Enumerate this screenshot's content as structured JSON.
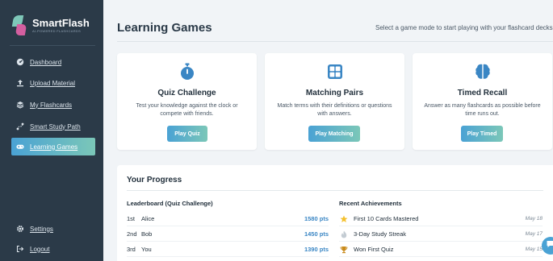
{
  "app": {
    "name": "SmartFlash",
    "tagline": "AI-POWERED FLASHCARDS"
  },
  "colors": {
    "sidebar_bg": "#2b3a48",
    "accent_blue": "#4aa2d4",
    "accent_teal": "#7bc7b8",
    "points_blue": "#3a86c4",
    "logo_pink": "#d45fa0"
  },
  "sidebar": {
    "items": [
      {
        "label": "Dashboard",
        "icon": "dashboard-gauge-icon",
        "active": false
      },
      {
        "label": "Upload Material",
        "icon": "upload-icon",
        "active": false
      },
      {
        "label": "My Flashcards",
        "icon": "layers-icon",
        "active": false
      },
      {
        "label": "Smart Study Path",
        "icon": "route-icon",
        "active": false
      },
      {
        "label": "Learning Games",
        "icon": "gamepad-icon",
        "active": true
      }
    ],
    "bottom_items": [
      {
        "label": "Settings",
        "icon": "gear-icon"
      },
      {
        "label": "Logout",
        "icon": "logout-icon"
      }
    ]
  },
  "main": {
    "title": "Learning Games",
    "subtitle": "Select a game mode to start playing with your flashcard decks."
  },
  "games": [
    {
      "title": "Quiz Challenge",
      "description": "Test your knowledge against the clock or compete with friends.",
      "button": "Play Quiz",
      "icon": "stopwatch-icon"
    },
    {
      "title": "Matching Pairs",
      "description": "Match terms with their definitions or questions with answers.",
      "button": "Play Matching",
      "icon": "grid-icon"
    },
    {
      "title": "Timed Recall",
      "description": "Answer as many flashcards as possible before time runs out.",
      "button": "Play Timed",
      "icon": "brain-icon"
    }
  ],
  "progress": {
    "title": "Your Progress",
    "leaderboard": {
      "heading": "Leaderboard (Quiz Challenge)",
      "rows": [
        {
          "rank": "1st",
          "name": "Alice",
          "points": "1580 pts"
        },
        {
          "rank": "2nd",
          "name": "Bob",
          "points": "1450 pts"
        },
        {
          "rank": "3rd",
          "name": "You",
          "points": "1390 pts"
        }
      ]
    },
    "achievements": {
      "heading": "Recent Achievements",
      "rows": [
        {
          "name": "First 10 Cards Mastered",
          "date": "May 18",
          "icon": "star-icon"
        },
        {
          "name": "3-Day Study Streak",
          "date": "May 17",
          "icon": "fire-icon"
        },
        {
          "name": "Won First Quiz",
          "date": "May 15",
          "icon": "trophy-icon"
        }
      ]
    }
  }
}
